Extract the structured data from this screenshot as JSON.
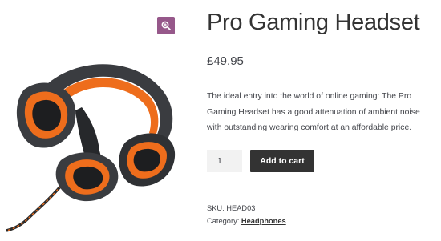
{
  "product": {
    "title": "Pro Gaming Headset",
    "price": "£49.95",
    "description": "The ideal entry into the world of online gaming: The Pro Gaming Headset has a good attenuation of ambient noise with outstanding wearing comfort at an affordable price.",
    "quantity": "1",
    "add_to_cart_label": "Add to cart",
    "sku_label": "SKU:",
    "sku": "HEAD03",
    "category_label": "Category:",
    "category": "Headphones"
  },
  "icons": {
    "zoom": "magnifier-plus-icon"
  },
  "colors": {
    "zoom_button": "#96588a",
    "button": "#333333",
    "headset_accent": "#ee6d1c",
    "headset_body": "#3a3c40"
  }
}
